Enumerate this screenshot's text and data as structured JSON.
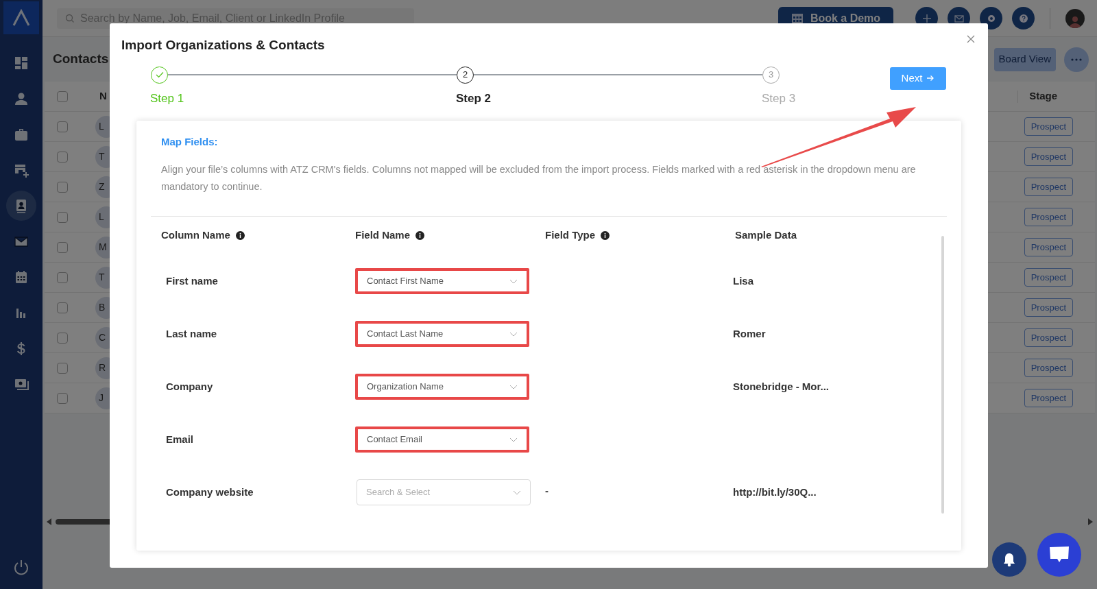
{
  "sidebar": {
    "items": [
      {
        "kind": "dashboard",
        "selected": false
      },
      {
        "kind": "person",
        "selected": false
      },
      {
        "kind": "briefcase",
        "selected": false
      },
      {
        "kind": "store",
        "selected": false
      },
      {
        "kind": "contact-card",
        "selected": true
      },
      {
        "kind": "mail",
        "selected": false
      },
      {
        "kind": "calendar",
        "selected": false
      },
      {
        "kind": "chart",
        "selected": false
      },
      {
        "kind": "dollar",
        "selected": false
      },
      {
        "kind": "cash",
        "selected": false
      }
    ]
  },
  "topbar": {
    "search": {
      "placeholder": "Search by Name, Job, Email, Client or LinkedIn Profile"
    },
    "demo_button": "Book a Demo"
  },
  "page": {
    "title": "Contacts",
    "board_view_button": "Board View",
    "columns": [
      "N",
      "Stage"
    ],
    "all_checked": false,
    "rows": [
      {
        "checked": false,
        "initials": "L",
        "stage": "Prospect"
      },
      {
        "checked": false,
        "initials": "T",
        "stage": "Prospect"
      },
      {
        "checked": false,
        "initials": "Z",
        "stage": "Prospect"
      },
      {
        "checked": false,
        "initials": "L",
        "stage": "Prospect"
      },
      {
        "checked": false,
        "initials": "M",
        "stage": "Prospect"
      },
      {
        "checked": false,
        "initials": "T",
        "stage": "Prospect"
      },
      {
        "checked": false,
        "initials": "B",
        "stage": "Prospect"
      },
      {
        "checked": false,
        "initials": "C",
        "stage": "Prospect"
      },
      {
        "checked": false,
        "initials": "R",
        "stage": "Prospect"
      },
      {
        "checked": false,
        "initials": "J",
        "stage": "Prospect"
      }
    ]
  },
  "modal": {
    "title": "Import Organizations & Contacts",
    "steps": [
      {
        "label": "Step 1",
        "done": true,
        "current": false
      },
      {
        "number": "2",
        "label": "Step 2",
        "done": false,
        "current": true
      },
      {
        "number": "3",
        "label": "Step 3",
        "done": false,
        "current": false
      }
    ],
    "next_button": "Next",
    "section_title": "Map Fields:",
    "description": "Align your file’s columns with ATZ CRM's fields. Columns not mapped will be excluded from the import process. Fields marked with a red asterisk in the dropdown menu are mandatory to continue.",
    "columns": [
      {
        "label": "Column Name",
        "info": true
      },
      {
        "label": "Field Name",
        "info": true
      },
      {
        "label": "Field Type",
        "info": true
      },
      {
        "label": "Sample Data",
        "info": false
      }
    ],
    "rows": [
      {
        "column": "First name",
        "field": {
          "value": "Contact First Name"
        },
        "sample": "Lisa",
        "highlighted": true
      },
      {
        "column": "Last name",
        "field": {
          "value": "Contact Last Name"
        },
        "sample": "Romer",
        "highlighted": true
      },
      {
        "column": "Company",
        "field": {
          "value": "Organization Name"
        },
        "sample": "Stonebridge - Mor...",
        "highlighted": true
      },
      {
        "column": "Email",
        "field": {
          "value": "Contact Email"
        },
        "highlighted": true
      },
      {
        "column": "Company website",
        "field": {
          "placeholder": "Search & Select"
        },
        "field_type": "-",
        "sample": "http://bit.ly/30Q...",
        "highlighted": false
      }
    ]
  }
}
